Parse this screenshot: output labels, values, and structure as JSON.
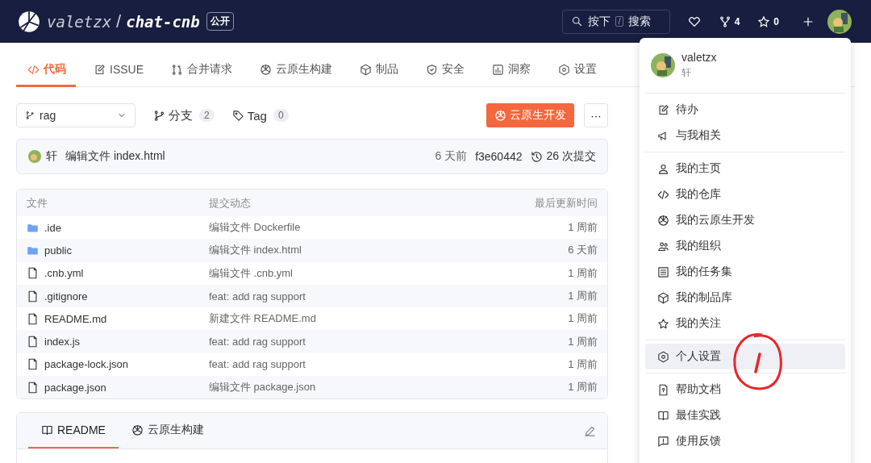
{
  "header": {
    "owner": "valetzx",
    "slash": "/",
    "repo": "chat-cnb",
    "visibility": "公开",
    "search": [
      "按下",
      "/",
      "搜索"
    ],
    "forks": "4",
    "stars": "0"
  },
  "tabs": [
    {
      "label": "代码",
      "kind": "code",
      "selected": true
    },
    {
      "label": "ISSUE",
      "kind": "edit",
      "selected": false
    },
    {
      "label": "合并请求",
      "kind": "merge",
      "selected": false
    },
    {
      "label": "云原生构建",
      "kind": "pinwheel",
      "selected": false
    },
    {
      "label": "制品",
      "kind": "cube",
      "selected": false
    },
    {
      "label": "安全",
      "kind": "shield",
      "selected": false
    },
    {
      "label": "洞察",
      "kind": "chart",
      "selected": false
    },
    {
      "label": "设置",
      "kind": "gear",
      "selected": false
    }
  ],
  "branch_bar": {
    "branch": "rag",
    "branches_label": "分支",
    "branches_count": "2",
    "tags_label": "Tag",
    "tags_count": "0",
    "dev_button": "云原生开发",
    "more": "···"
  },
  "commit": {
    "author": "轩",
    "message": "编辑文件 index.html",
    "time": "6 天前",
    "hash": "f3e60442",
    "count": "26 次提交"
  },
  "files": {
    "columns": [
      "文件",
      "提交动态",
      "最后更新时间"
    ],
    "rows": [
      {
        "kind": "folder",
        "name": ".ide",
        "message": "编辑文件 Dockerfile",
        "time": "1 周前"
      },
      {
        "kind": "folder",
        "name": "public",
        "message": "编辑文件 index.html",
        "time": "6 天前"
      },
      {
        "kind": "file",
        "name": ".cnb.yml",
        "message": "编辑文件 .cnb.yml",
        "time": "1 周前"
      },
      {
        "kind": "file",
        "name": ".gitignore",
        "message": "feat: add rag support",
        "time": "1 周前"
      },
      {
        "kind": "file",
        "name": "README.md",
        "message": "新建文件 README.md",
        "time": "1 周前"
      },
      {
        "kind": "file",
        "name": "index.js",
        "message": "feat: add rag support",
        "time": "1 周前"
      },
      {
        "kind": "file",
        "name": "package-lock.json",
        "message": "feat: add rag support",
        "time": "1 周前"
      },
      {
        "kind": "file",
        "name": "package.json",
        "message": "编辑文件 package.json",
        "time": "1 周前"
      }
    ]
  },
  "readme_tabs": [
    {
      "label": "README",
      "kind": "book",
      "selected": true
    },
    {
      "label": "云原生构建",
      "kind": "pinwheel",
      "selected": false
    }
  ],
  "user_menu": {
    "name": "valetzx",
    "nickname": "轩",
    "groups": [
      [
        {
          "label": "待办",
          "kind": "edit",
          "selected": false
        },
        {
          "label": "与我相关",
          "kind": "megaphone",
          "selected": false
        }
      ],
      [
        {
          "label": "我的主页",
          "kind": "user",
          "selected": false
        },
        {
          "label": "我的仓库",
          "kind": "code",
          "selected": false
        },
        {
          "label": "我的云原生开发",
          "kind": "pinwheel",
          "selected": false
        },
        {
          "label": "我的组织",
          "kind": "users",
          "selected": false
        },
        {
          "label": "我的任务集",
          "kind": "list",
          "selected": false
        },
        {
          "label": "我的制品库",
          "kind": "cube",
          "selected": false
        },
        {
          "label": "我的关注",
          "kind": "star",
          "selected": false
        }
      ],
      [
        {
          "label": "个人设置",
          "kind": "gear",
          "selected": true
        }
      ],
      [
        {
          "label": "帮助文档",
          "kind": "doc",
          "selected": false
        },
        {
          "label": "最佳实践",
          "kind": "book",
          "selected": false
        },
        {
          "label": "使用反馈",
          "kind": "feedback",
          "selected": false
        }
      ]
    ]
  }
}
